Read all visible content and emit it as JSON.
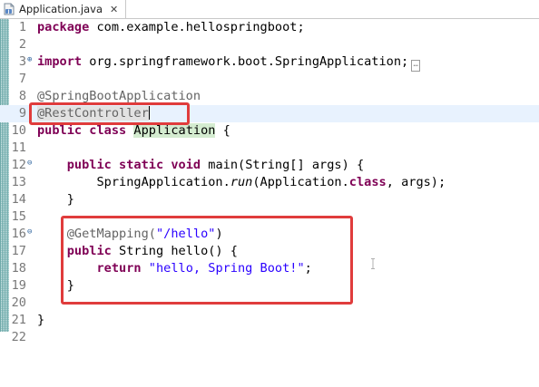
{
  "tab": {
    "filename": "Application.java",
    "close": "✕",
    "icon": "java-file-icon"
  },
  "editor": {
    "lines": {
      "l1": {
        "num": "1",
        "kw": "package",
        "text": " com.example.hellospringboot;"
      },
      "l2": {
        "num": "2"
      },
      "l3": {
        "num": "3",
        "kw": "import",
        "text": " org.springframework.boot.SpringApplication;"
      },
      "l7": {
        "num": "7"
      },
      "l8": {
        "num": "8",
        "ann": "@SpringBootApplication"
      },
      "l9": {
        "num": "9",
        "ann": "@RestController"
      },
      "l10": {
        "num": "10",
        "kw1": "public",
        "kw2": "class",
        "cls": "Application",
        "rest": " {"
      },
      "l11": {
        "num": "11"
      },
      "l12": {
        "num": "12",
        "kw1": "public",
        "kw2": "static",
        "kw3": "void",
        "text": " main(String[] ",
        "param": "args",
        "rest": ") {"
      },
      "l13": {
        "num": "13",
        "pre": "SpringApplication.",
        "method": "run",
        "mid": "(Application.",
        "kw": "class",
        "post": ", args);"
      },
      "l14": {
        "num": "14",
        "text": "}"
      },
      "l15": {
        "num": "15"
      },
      "l16": {
        "num": "16",
        "ann": "@GetMapping(",
        "str": "\"/hello\"",
        "rest": ")"
      },
      "l17": {
        "num": "17",
        "kw": "public",
        "text": " String hello() {"
      },
      "l18": {
        "num": "18",
        "kw": "return",
        "str": "\"hello, Spring Boot!\"",
        "rest": ";"
      },
      "l19": {
        "num": "19",
        "text": "}"
      },
      "l20": {
        "num": "20"
      },
      "l21": {
        "num": "21",
        "text": "}"
      },
      "l22": {
        "num": "22"
      }
    },
    "fold_collapsed": "⊕",
    "fold_expanded": "⊖",
    "collapsed_marker": "…"
  },
  "colors": {
    "keyword": "#7f0055",
    "annotation": "#646464",
    "string": "#2a00ff",
    "highlight_box": "#e03c3c",
    "current_line": "#e8f2fe"
  }
}
